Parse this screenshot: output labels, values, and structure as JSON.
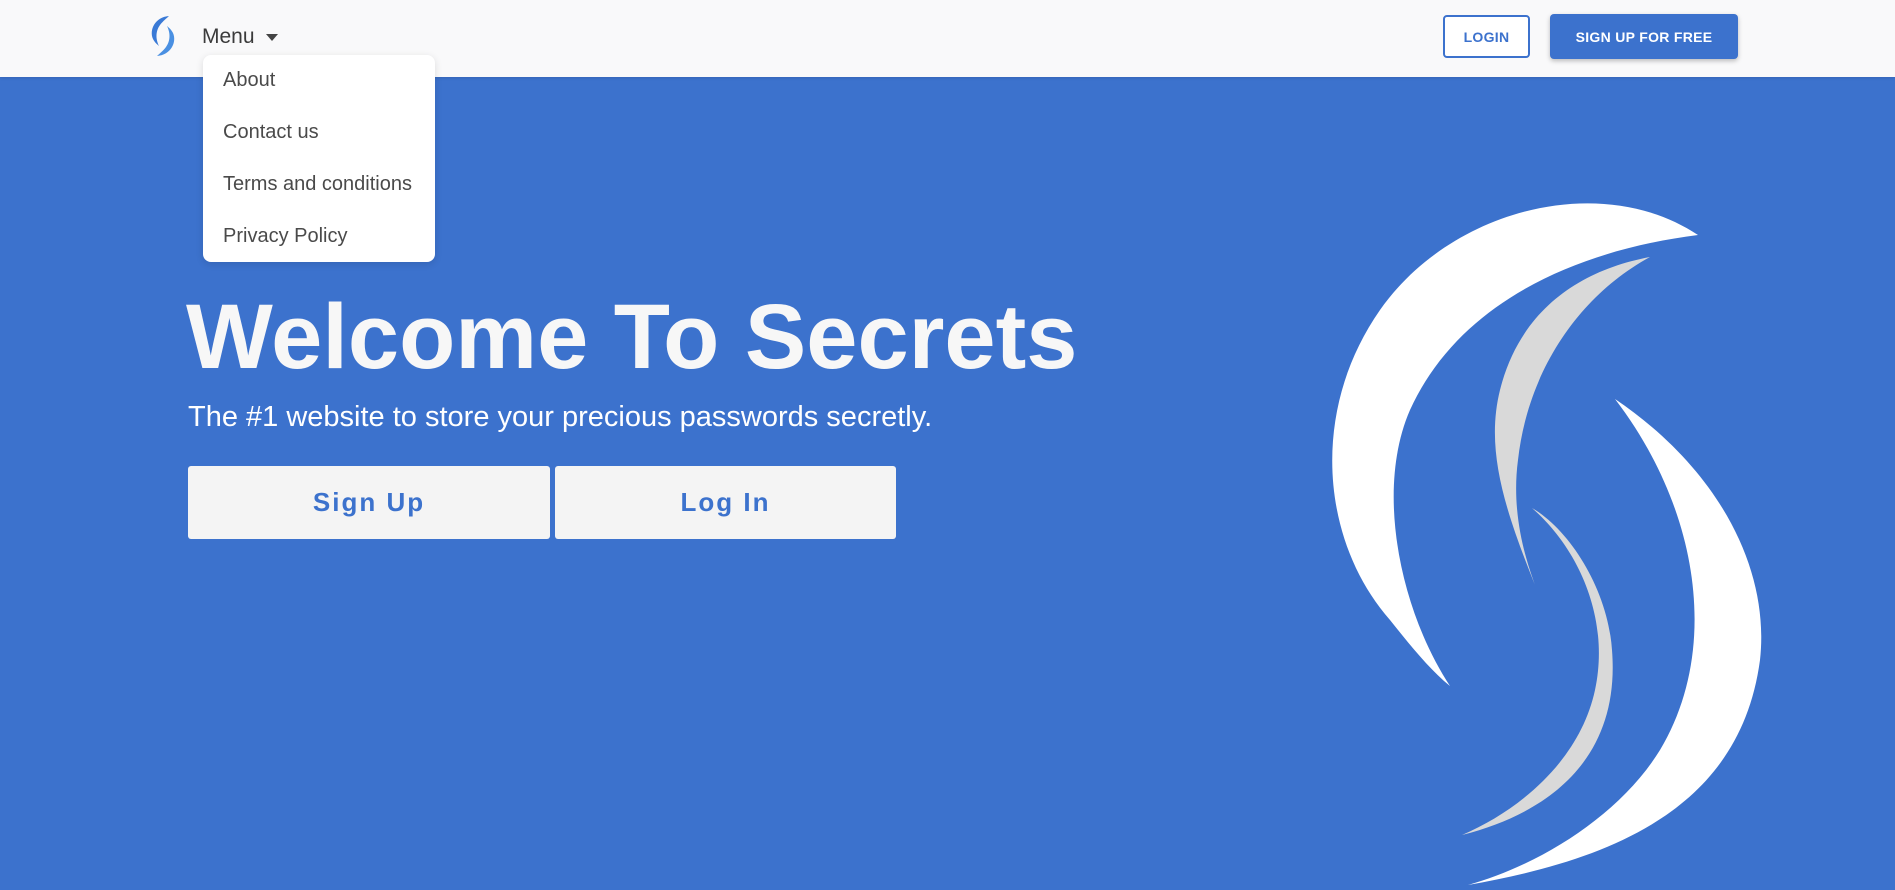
{
  "navbar": {
    "logo_icon": "swirl-s-logo-icon",
    "menu_label": "Menu",
    "login_label": "LOGIN",
    "signup_label": "SIGN UP FOR FREE"
  },
  "dropdown": {
    "items": [
      {
        "label": "About"
      },
      {
        "label": "Contact us"
      },
      {
        "label": "Terms and conditions"
      },
      {
        "label": "Privacy Policy"
      }
    ]
  },
  "hero": {
    "title": "Welcome To Secrets",
    "subtitle": "The #1 website to store your precious passwords secretly.",
    "signup_button": "Sign Up",
    "login_button": "Log In"
  },
  "colors": {
    "accent": "#3c72cd",
    "navbar_bg": "#f9f9fa",
    "logo_white": "#ffffff",
    "logo_gray": "#d9d9d9"
  }
}
